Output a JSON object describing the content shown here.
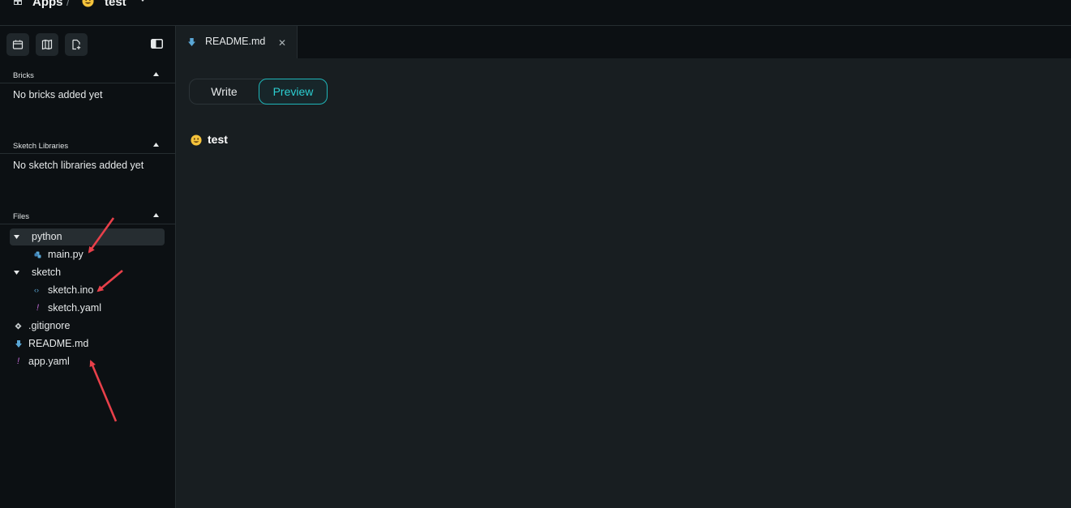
{
  "breadcrumb": {
    "root": "Apps",
    "separator": "/",
    "app_name": "test"
  },
  "sidebar": {
    "toolbar": [
      "add-brick-icon",
      "library-icon",
      "new-file-icon"
    ],
    "bricks": {
      "title": "Bricks",
      "empty": "No bricks added yet"
    },
    "libraries": {
      "title": "Sketch Libraries",
      "empty": "No sketch libraries added yet"
    },
    "files": {
      "title": "Files",
      "items": [
        {
          "label": "python",
          "type": "folder",
          "expanded": true,
          "selected": true
        },
        {
          "label": "main.py",
          "type": "python-file"
        },
        {
          "label": "sketch",
          "type": "folder",
          "expanded": true
        },
        {
          "label": "sketch.ino",
          "type": "arduino-file"
        },
        {
          "label": "sketch.yaml",
          "type": "yaml-file"
        },
        {
          "label": ".gitignore",
          "type": "git-file"
        },
        {
          "label": "README.md",
          "type": "markdown-file"
        },
        {
          "label": "app.yaml",
          "type": "yaml-file"
        }
      ]
    }
  },
  "tabs": [
    {
      "label": "README.md",
      "icon": "markdown-icon",
      "active": true
    }
  ],
  "editor": {
    "modes": {
      "write": "Write",
      "preview": "Preview",
      "active": "Preview"
    },
    "preview_title": "test"
  },
  "colors": {
    "accent": "#2ccfd2",
    "annotation": "#e8404a",
    "yaml": "#c36ad8",
    "markdown": "#5aa7d6"
  }
}
